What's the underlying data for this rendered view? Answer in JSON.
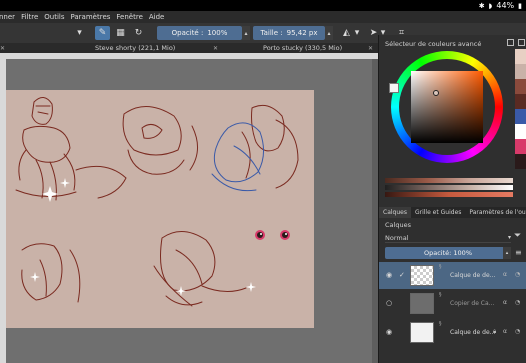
{
  "statusbar": {
    "battery": "44%"
  },
  "menubar": {
    "items": [
      "nner",
      "Filtre",
      "Outils",
      "Paramètres",
      "Fenêtre",
      "Aide"
    ]
  },
  "toolbar": {
    "opacity_label": "Opacité :",
    "opacity_value": "100%",
    "size_label": "Taille :",
    "size_value": "95,42 px"
  },
  "tabs": [
    {
      "label": "Steve shorty (221,1 Mio)"
    },
    {
      "label": "Porto stucky (330,5 Mio)"
    }
  ],
  "color_panel": {
    "title": "Sélecteur de couleurs avancé"
  },
  "panel_tabs": [
    "Calques",
    "Grille et Guides",
    "Paramètres de l'outil"
  ],
  "layers_panel": {
    "title": "Calques",
    "blend_mode": "Normal",
    "opacity_label": "Opacité:",
    "opacity_value": "100%",
    "layers": [
      {
        "name": "Calque de de...",
        "selected": true
      },
      {
        "name": "Copier de Ca...",
        "selected": false
      },
      {
        "name": "Calque de de...",
        "selected": false
      }
    ]
  },
  "colors": {
    "accent": "#4e6d92",
    "paper": "#c9b2a8",
    "sketch": "#7a2a20",
    "sketch_blue": "#3a5aa8"
  }
}
